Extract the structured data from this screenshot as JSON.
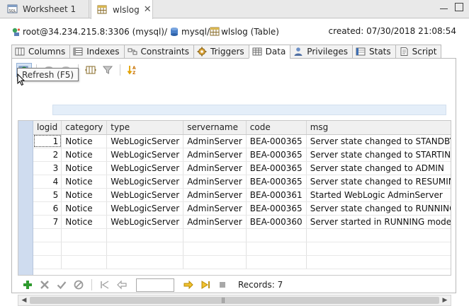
{
  "editor_tabs": [
    {
      "label": "Worksheet 1",
      "icon": "sql-worksheet-icon",
      "active": false
    },
    {
      "label": "wlslog",
      "icon": "table-icon",
      "active": true
    }
  ],
  "path": {
    "connection": "root@34.234.215.8:3306 (mysql)",
    "sep1": "/",
    "database": "mysql",
    "sep2": "/",
    "table": "wlslog (Table)"
  },
  "created": "created: 07/30/2018 21:08:54",
  "sub_tabs": [
    {
      "label": "Columns",
      "icon": "columns-icon"
    },
    {
      "label": "Indexes",
      "icon": "indexes-icon"
    },
    {
      "label": "Constraints",
      "icon": "constraints-icon"
    },
    {
      "label": "Triggers",
      "icon": "triggers-icon"
    },
    {
      "label": "Data",
      "icon": "data-grid-icon",
      "active": true
    },
    {
      "label": "Privileges",
      "icon": "privileges-icon"
    },
    {
      "label": "Stats",
      "icon": "stats-icon"
    },
    {
      "label": "Script",
      "icon": "script-icon"
    }
  ],
  "tooltip": "Refresh (F5)",
  "grid": {
    "columns": [
      "logid",
      "category",
      "type",
      "servername",
      "code",
      "msg"
    ],
    "rows": [
      [
        "1",
        "Notice",
        "WebLogicServer",
        "AdminServer",
        "BEA-000365",
        "Server state changed to STANDBY"
      ],
      [
        "2",
        "Notice",
        "WebLogicServer",
        "AdminServer",
        "BEA-000365",
        "Server state changed to STARTING"
      ],
      [
        "3",
        "Notice",
        "WebLogicServer",
        "AdminServer",
        "BEA-000365",
        "Server state changed to ADMIN"
      ],
      [
        "4",
        "Notice",
        "WebLogicServer",
        "AdminServer",
        "BEA-000365",
        "Server state changed to RESUMING"
      ],
      [
        "5",
        "Notice",
        "WebLogicServer",
        "AdminServer",
        "BEA-000361",
        "Started WebLogic AdminServer"
      ],
      [
        "6",
        "Notice",
        "WebLogicServer",
        "AdminServer",
        "BEA-000365",
        "Server state changed to RUNNING"
      ],
      [
        "7",
        "Notice",
        "WebLogicServer",
        "AdminServer",
        "BEA-000360",
        "Server started in RUNNING mode"
      ]
    ]
  },
  "records": "Records: 7",
  "page_input": "",
  "colors": {
    "row_header": "#cfdcef",
    "filter_bar": "#e4eef9",
    "add_green": "#2e9a2e",
    "nav_yellow": "#e8b400"
  }
}
